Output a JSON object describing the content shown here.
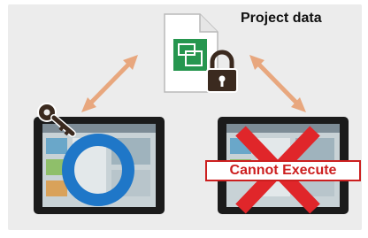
{
  "title": "Project data",
  "blocked_label": "Cannot Execute",
  "icons": {
    "file": "project-file-icon",
    "lock": "padlock-icon",
    "key": "key-icon",
    "ok": "blue-circle-ok-icon",
    "ng": "red-x-icon"
  },
  "colors": {
    "background": "#ececec",
    "arrow": "#e8a77e",
    "ok_circle": "#1f77c8",
    "ng_cross": "#e0262a",
    "lock": "#3b2a1f",
    "key": "#3b2a1f"
  }
}
